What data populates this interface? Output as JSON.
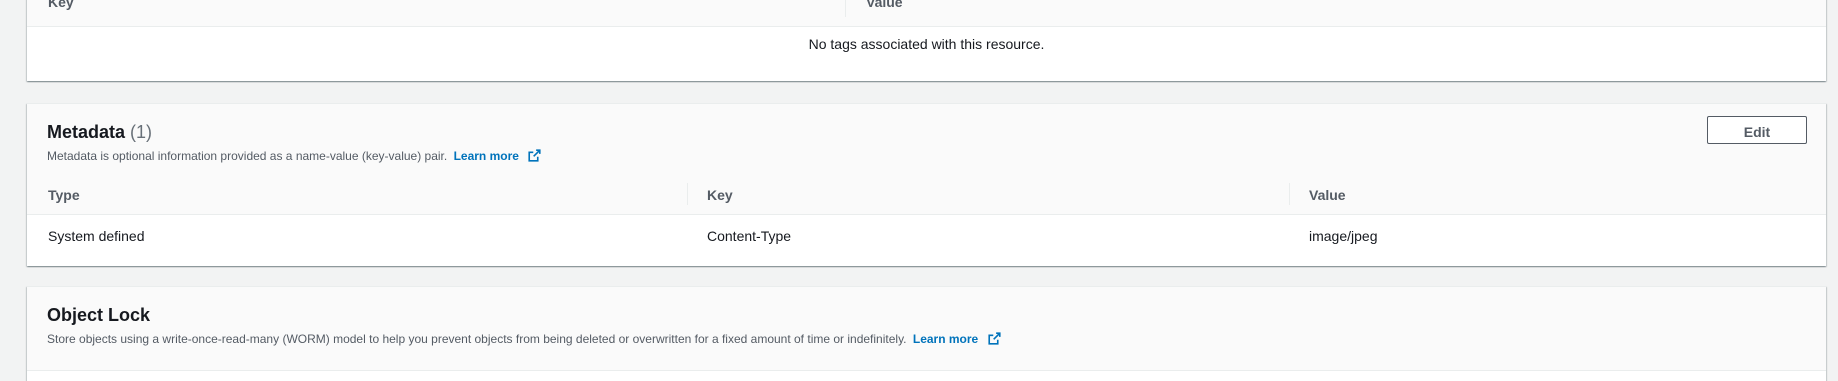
{
  "tags": {
    "columns": [
      "Key",
      "Value"
    ],
    "empty_message": "No tags associated with this resource."
  },
  "metadata": {
    "title": "Metadata",
    "count": "(1)",
    "description": "Metadata is optional information provided as a name-value (key-value) pair.",
    "learn_more": "Learn more",
    "edit_label": "Edit",
    "columns": [
      "Type",
      "Key",
      "Value"
    ],
    "rows": [
      [
        "System defined",
        "Content-Type",
        "image/jpeg"
      ]
    ]
  },
  "object_lock": {
    "title": "Object Lock",
    "description": "Store objects using a write-once-read-many (WORM) model to help you prevent objects from being deleted or overwritten for a fixed amount of time or indefinitely.",
    "learn_more": "Learn more"
  },
  "colors": {
    "background": "#f2f3f3",
    "link": "#0073bb",
    "text": "#16191f",
    "muted": "#545b64"
  },
  "icons": [
    "external-link-icon"
  ]
}
